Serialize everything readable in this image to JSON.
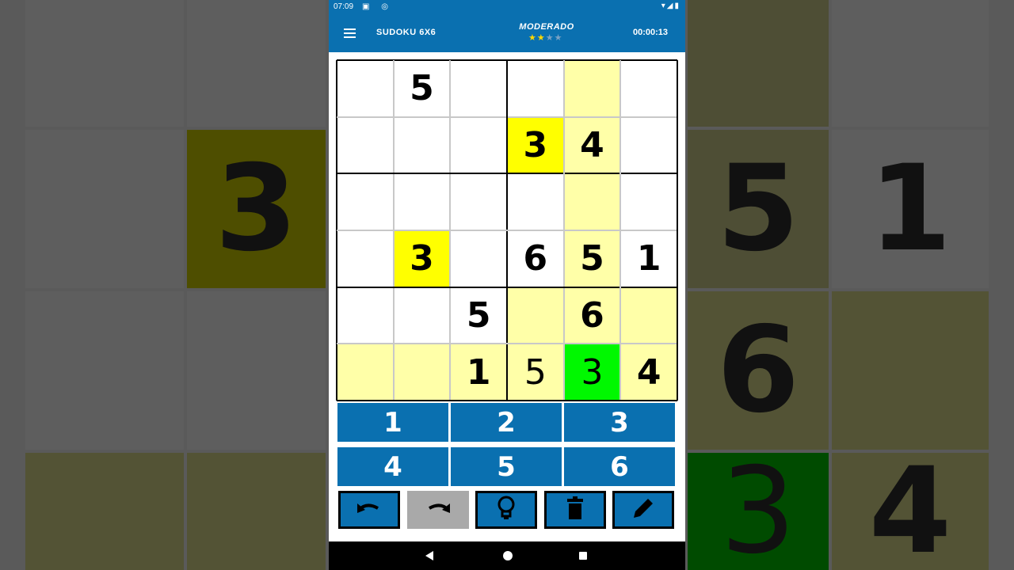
{
  "status": {
    "time": "07:09"
  },
  "app": {
    "title": "SUDOKU 6X6",
    "difficulty": "MODERADO",
    "stars_filled": 2,
    "stars_total": 4,
    "timer": "00:00:13"
  },
  "board": {
    "rows": [
      [
        "",
        "5",
        "",
        "",
        "",
        ""
      ],
      [
        "",
        "",
        "",
        "3",
        "4",
        ""
      ],
      [
        "",
        "",
        "",
        "",
        "",
        ""
      ],
      [
        "",
        "3",
        "",
        "6",
        "5",
        "1"
      ],
      [
        "",
        "",
        "5",
        "",
        "6",
        ""
      ],
      [
        "",
        "",
        "1",
        "5",
        "3",
        "4"
      ]
    ],
    "user_entered": [
      [
        5,
        3
      ],
      [
        5,
        4
      ]
    ],
    "highlight_light": [
      [
        0,
        4
      ],
      [
        1,
        4
      ],
      [
        2,
        4
      ],
      [
        3,
        4
      ],
      [
        4,
        3
      ],
      [
        4,
        4
      ],
      [
        4,
        5
      ],
      [
        5,
        0
      ],
      [
        5,
        1
      ],
      [
        5,
        2
      ],
      [
        5,
        3
      ],
      [
        5,
        5
      ]
    ],
    "highlight_same": [
      [
        1,
        3
      ],
      [
        3,
        1
      ]
    ],
    "selected": [
      5,
      4
    ],
    "colors": {
      "light": "#ffffa8",
      "same": "#ffff00",
      "selected": "#00f800",
      "white": "#ffffff"
    }
  },
  "numpad": [
    "1",
    "2",
    "3",
    "4",
    "5",
    "6"
  ],
  "tools": [
    {
      "icon": "undo-icon",
      "disabled": false
    },
    {
      "icon": "redo-icon",
      "disabled": true
    },
    {
      "icon": "lightbulb-icon",
      "disabled": false
    },
    {
      "icon": "trash-icon",
      "disabled": false
    },
    {
      "icon": "pencil-icon",
      "disabled": false
    }
  ],
  "theme": {
    "primary": "#0a70b0"
  }
}
